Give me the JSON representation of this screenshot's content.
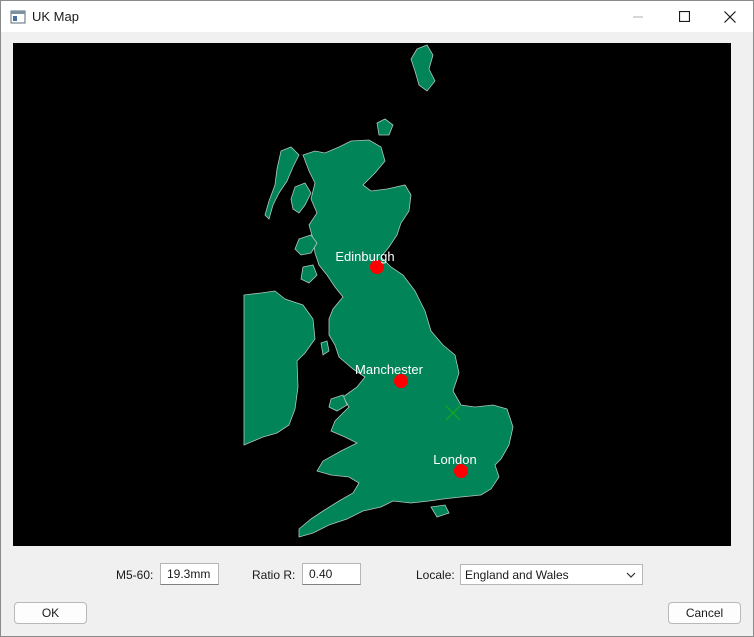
{
  "window": {
    "title": "UK Map"
  },
  "map": {
    "land_color": "#008458",
    "coast_color": "#b0c8bc",
    "background": "#000000",
    "city_marker_color": "#ff0000",
    "centroid_marker_color": "#13a324",
    "cities": [
      {
        "name": "Edinburgh"
      },
      {
        "name": "Manchester"
      },
      {
        "name": "London"
      }
    ],
    "centroid_icon": "cross-marker-icon"
  },
  "controls": {
    "m5_label": "M5-60:",
    "m5_value": "19.3mm",
    "ratio_label": "Ratio R:",
    "ratio_value": "0.40",
    "locale_label": "Locale:",
    "locale_value": "England and Wales"
  },
  "buttons": {
    "ok": "OK",
    "cancel": "Cancel"
  }
}
